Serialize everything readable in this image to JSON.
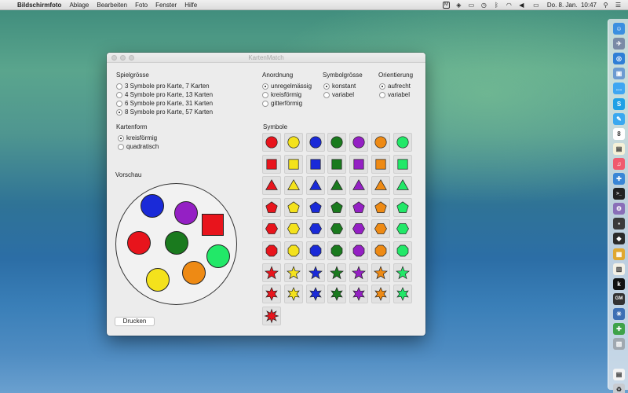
{
  "menubar": {
    "app_name": "Bildschirmfoto",
    "items": [
      "Ablage",
      "Bearbeiten",
      "Foto",
      "Fenster",
      "Hilfe"
    ],
    "clock": "Do. 8. Jan.  10:47",
    "icons": [
      "apple-icon",
      "status-icon",
      "dropbox-icon",
      "airplay-icon",
      "time-machine-icon",
      "bluetooth-icon",
      "wifi-icon",
      "volume-icon",
      "battery-icon",
      "spotlight-icon",
      "notification-center-icon"
    ]
  },
  "window": {
    "title": "KartenMatch",
    "spielgroesse": {
      "label": "Spielgrösse",
      "options": [
        "3 Symbole pro Karte, 7 Karten",
        "4 Symbole pro Karte, 13 Karten",
        "6 Symbole pro Karte, 31 Karten",
        "8 Symbole pro Karte, 57 Karten"
      ],
      "selected": 3
    },
    "kartenform": {
      "label": "Kartenform",
      "options": [
        "kreisförmig",
        "quadratisch"
      ],
      "selected": 0
    },
    "anordnung": {
      "label": "Anordnung",
      "options": [
        "unregelmässig",
        "kreisförmig",
        "gitterförmig"
      ],
      "selected": 0
    },
    "symbolgroesse": {
      "label": "Symbolgrösse",
      "options": [
        "konstant",
        "variabel"
      ],
      "selected": 0
    },
    "orientierung": {
      "label": "Orientierung",
      "options": [
        "aufrecht",
        "variabel"
      ],
      "selected": 0
    },
    "vorschau_label": "Vorschau",
    "symbole_label": "Symbole",
    "print_button": "Drucken",
    "colors": {
      "red": "#e8141c",
      "yellow": "#f4e21c",
      "blue": "#1a2ad8",
      "green": "#1a7a1e",
      "purple": "#9420c4",
      "orange": "#ee8a14",
      "lightgreen": "#22e868"
    },
    "preview_symbols": [
      {
        "shape": "circle",
        "color": "blue"
      },
      {
        "shape": "circle",
        "color": "purple"
      },
      {
        "shape": "square",
        "color": "red"
      },
      {
        "shape": "circle",
        "color": "red"
      },
      {
        "shape": "circle",
        "color": "green"
      },
      {
        "shape": "circle",
        "color": "lightgreen"
      },
      {
        "shape": "circle",
        "color": "yellow"
      },
      {
        "shape": "circle",
        "color": "orange"
      }
    ],
    "symbol_rows": [
      {
        "shape": "circle",
        "colors": [
          "red",
          "yellow",
          "blue",
          "green",
          "purple",
          "orange",
          "lightgreen"
        ]
      },
      {
        "shape": "square",
        "colors": [
          "red",
          "yellow",
          "blue",
          "green",
          "purple",
          "orange",
          "lightgreen"
        ]
      },
      {
        "shape": "triangle",
        "colors": [
          "red",
          "yellow",
          "blue",
          "green",
          "purple",
          "orange",
          "lightgreen"
        ]
      },
      {
        "shape": "pentagon",
        "colors": [
          "red",
          "yellow",
          "blue",
          "green",
          "purple",
          "orange",
          "lightgreen"
        ]
      },
      {
        "shape": "hexagon",
        "colors": [
          "red",
          "yellow",
          "blue",
          "green",
          "purple",
          "orange",
          "lightgreen"
        ]
      },
      {
        "shape": "octagon",
        "colors": [
          "red",
          "yellow",
          "blue",
          "green",
          "purple",
          "orange",
          "lightgreen"
        ]
      },
      {
        "shape": "star5",
        "colors": [
          "red",
          "yellow",
          "blue",
          "green",
          "purple",
          "orange",
          "lightgreen"
        ]
      },
      {
        "shape": "star6",
        "colors": [
          "red",
          "yellow",
          "blue",
          "green",
          "purple",
          "orange",
          "lightgreen"
        ]
      },
      {
        "shape": "star8",
        "colors": [
          "red"
        ]
      }
    ]
  },
  "dock": {
    "icons": [
      "finder-icon",
      "launchpad-icon",
      "safari-icon",
      "preview-icon",
      "messages-icon",
      "skype-icon",
      "twitter-icon",
      "calendar-icon",
      "notes-icon",
      "itunes-icon",
      "xcode-icon",
      "terminal-icon",
      "automator-icon",
      "app-icon",
      "app-icon",
      "app-icon",
      "books-icon",
      "kindle-icon",
      "graphicsmagick-icon",
      "app-icon",
      "app-icon",
      "app-icon",
      "document-icon",
      "trash-icon"
    ]
  }
}
